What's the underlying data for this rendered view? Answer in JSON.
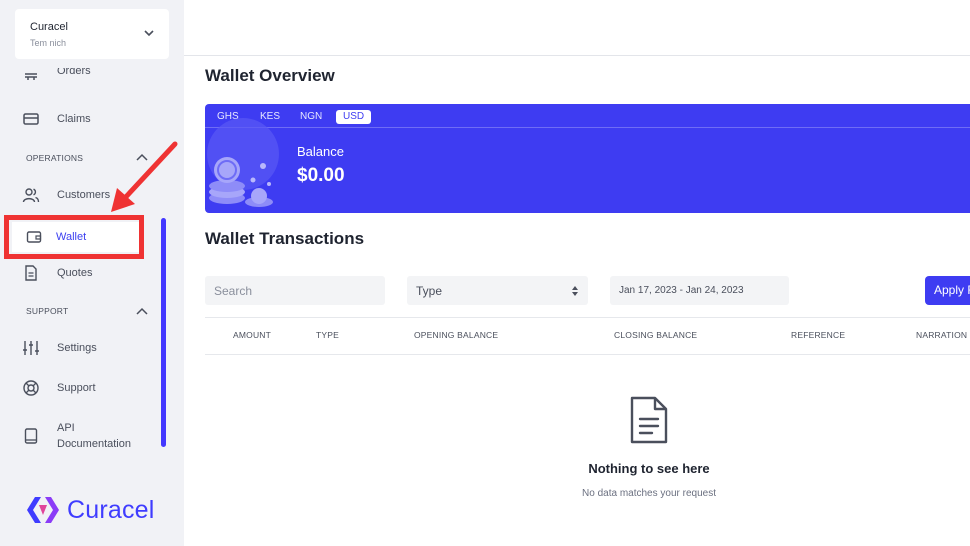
{
  "org": {
    "name": "Curacel",
    "subtitle": "Tem nich"
  },
  "nav": {
    "orders": "Orders",
    "claims": "Claims",
    "operations_header": "OPERATIONS",
    "customers": "Customers",
    "wallet": "Wallet",
    "quotes": "Quotes",
    "support_header": "SUPPORT",
    "settings": "Settings",
    "support": "Support",
    "api_docs": "API\nDocumentation"
  },
  "brand": {
    "name": "Curacel",
    "color": "#3f3cff"
  },
  "wallet_overview": {
    "title": "Wallet Overview",
    "tabs": [
      "GHS",
      "KES",
      "NGN",
      "USD"
    ],
    "active_tab": "USD",
    "balance_label": "Balance",
    "balance_value": "$0.00",
    "banner_color": "#3e3cf2"
  },
  "transactions": {
    "title": "Wallet Transactions",
    "search_placeholder": "Search",
    "type_value": "Type",
    "date_range": "Jan 17, 2023 - Jan 24, 2023",
    "apply_label": "Apply Filter",
    "columns": [
      "AMOUNT",
      "TYPE",
      "OPENING BALANCE",
      "CLOSING BALANCE",
      "REFERENCE",
      "NARRATION"
    ],
    "empty_title": "Nothing to see here",
    "empty_subtitle": "No data matches your request"
  },
  "annotation": {
    "color": "#ef3333"
  }
}
